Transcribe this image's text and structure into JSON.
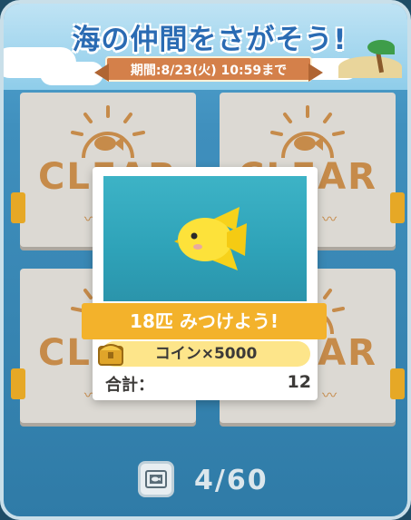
{
  "header": {
    "title": "海の仲間をさがそう!",
    "period": "期間:8/23(火) 10:59まで"
  },
  "cards": [
    {
      "label": "CLEAR"
    },
    {
      "label": "CLEAR"
    },
    {
      "label": "CLEAR"
    },
    {
      "label": "CLEAR"
    }
  ],
  "popup": {
    "goal": "18匹 みつけよう!",
    "reward": "コイン×5000",
    "total_label": "合計：",
    "total_value": "12"
  },
  "footer": {
    "progress": "4/60",
    "icon": "photo-album-icon"
  },
  "colors": {
    "accent_orange": "#f3b22b",
    "clear_brown": "#c68b4a",
    "reward_yellow": "#fde58a",
    "sea_blue": "#2ea2b8"
  }
}
